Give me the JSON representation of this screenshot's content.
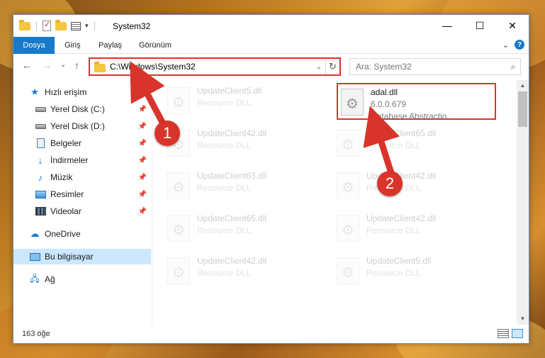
{
  "window": {
    "title": "System32",
    "controls": {
      "minimize": "—",
      "maximize": "☐",
      "close": "✕"
    }
  },
  "ribbon": {
    "tabs": [
      "Dosya",
      "Giriş",
      "Paylaş",
      "Görünüm"
    ],
    "expand": "⌄",
    "help": "?"
  },
  "address_bar": {
    "path": "C:\\Windows\\System32",
    "dropdown": "⌄",
    "refresh": "↻"
  },
  "search": {
    "placeholder": "Ara: System32",
    "icon": "⌕"
  },
  "nav_buttons": {
    "back": "←",
    "forward": "→",
    "recent": "⌄",
    "up": "↑"
  },
  "sidebar": {
    "items": [
      {
        "label": "Hızlı erişim",
        "icon": "star-icon"
      },
      {
        "label": "Yerel Disk (C:)",
        "icon": "disk-icon",
        "pinned": true
      },
      {
        "label": "Yerel Disk (D:)",
        "icon": "disk-icon",
        "pinned": true
      },
      {
        "label": "Belgeler",
        "icon": "documents-icon",
        "pinned": true
      },
      {
        "label": "İndirmeler",
        "icon": "downloads-icon",
        "pinned": true
      },
      {
        "label": "Müzik",
        "icon": "music-icon",
        "pinned": true
      },
      {
        "label": "Resimler",
        "icon": "pictures-icon",
        "pinned": true
      },
      {
        "label": "Videolar",
        "icon": "videos-icon",
        "pinned": true
      },
      {
        "label": "OneDrive",
        "icon": "onedrive-icon"
      },
      {
        "label": "Bu bilgisayar",
        "icon": "this-pc-icon",
        "selected": true
      },
      {
        "label": "Ağ",
        "icon": "network-icon"
      }
    ]
  },
  "files": [
    {
      "name": "UpdateClient5.dll",
      "type": "Resource DLL"
    },
    {
      "name": "adal.dll",
      "version": "6.0.0.679",
      "description": "Database Abstractio...",
      "highlighted": true
    },
    {
      "name": "UpdateClient42.dll",
      "type": "Resource DLL"
    },
    {
      "name": "UpdateClient65.dll",
      "type": "Resource DLL"
    },
    {
      "name": "UpdateClient63.dll",
      "type": "Resource DLL"
    },
    {
      "name": "UpdateClient42.dll",
      "type": "Resource DLL"
    },
    {
      "name": "UpdateClient65.dll",
      "type": "Resource DLL"
    },
    {
      "name": "UpdateClient42.dll",
      "type": "Resource DLL"
    },
    {
      "name": "UpdateClient42.dll",
      "type": "Resource DLL"
    },
    {
      "name": "UpdateClient5.dll",
      "type": "Resource DLL"
    }
  ],
  "status": {
    "item_count": "163 öğe"
  },
  "annotations": {
    "step1": "1",
    "step2": "2",
    "color": "#d9342b"
  }
}
